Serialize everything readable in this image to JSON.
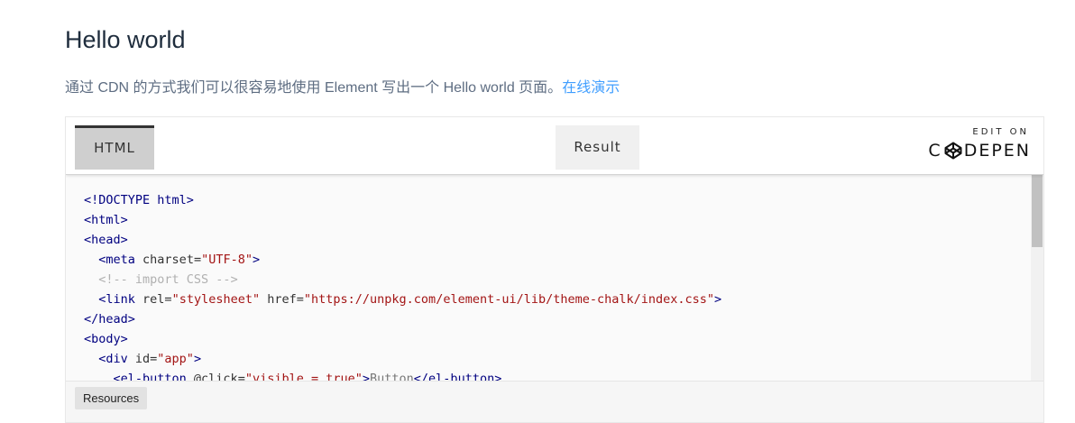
{
  "page": {
    "title": "Hello world",
    "intro_text": "通过 CDN 的方式我们可以很容易地使用 Element 写出一个 Hello world 页面。",
    "intro_link": "在线演示"
  },
  "embed": {
    "tabs": {
      "html": "HTML",
      "result": "Result"
    },
    "codepen": {
      "edit_on": "EDIT ON",
      "brand_left": "C",
      "brand_right": "DEPEN",
      "logo_icon": "codepen-cube-icon"
    },
    "code_lines": [
      [
        {
          "t": "t",
          "s": "<!DOCTYPE html>"
        }
      ],
      [
        {
          "t": "t",
          "s": "<html>"
        }
      ],
      [
        {
          "t": "t",
          "s": "<head>"
        }
      ],
      [
        {
          "t": "p",
          "s": "  "
        },
        {
          "t": "t",
          "s": "<meta "
        },
        {
          "t": "a",
          "s": "charset="
        },
        {
          "t": "v",
          "s": "\"UTF-8\""
        },
        {
          "t": "t",
          "s": ">"
        }
      ],
      [
        {
          "t": "p",
          "s": "  "
        },
        {
          "t": "c",
          "s": "<!-- import CSS -->"
        }
      ],
      [
        {
          "t": "p",
          "s": "  "
        },
        {
          "t": "t",
          "s": "<link "
        },
        {
          "t": "a",
          "s": "rel="
        },
        {
          "t": "v",
          "s": "\"stylesheet\""
        },
        {
          "t": "a",
          "s": " href="
        },
        {
          "t": "v",
          "s": "\"https://unpkg.com/element-ui/lib/theme-chalk/index.css\""
        },
        {
          "t": "t",
          "s": ">"
        }
      ],
      [
        {
          "t": "t",
          "s": "</head>"
        }
      ],
      [
        {
          "t": "t",
          "s": "<body>"
        }
      ],
      [
        {
          "t": "p",
          "s": "  "
        },
        {
          "t": "t",
          "s": "<div "
        },
        {
          "t": "a",
          "s": "id="
        },
        {
          "t": "v",
          "s": "\"app\""
        },
        {
          "t": "t",
          "s": ">"
        }
      ],
      [
        {
          "t": "p",
          "s": "    "
        },
        {
          "t": "t",
          "s": "<el-button "
        },
        {
          "t": "a",
          "s": "@click="
        },
        {
          "t": "v",
          "s": "\"visible = true\""
        },
        {
          "t": "t",
          "s": ">"
        },
        {
          "t": "txt",
          "s": "Button"
        },
        {
          "t": "t",
          "s": "</el-button>"
        }
      ]
    ],
    "footer": {
      "resources_label": "Resources"
    }
  },
  "colors": {
    "title": "#1f2d3d",
    "body_text": "#5e6d82",
    "link": "#409eff",
    "code_tag": "#000080",
    "code_value": "#a31515",
    "code_comment": "#b0b0b0"
  }
}
